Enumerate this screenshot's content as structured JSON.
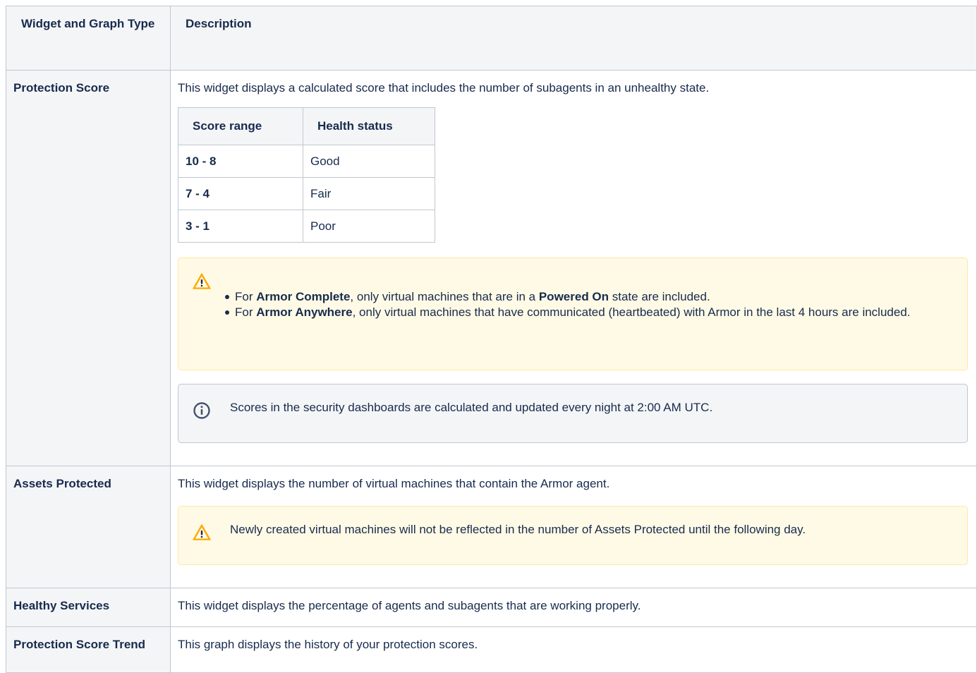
{
  "header": {
    "col1": "Widget and Graph Type",
    "col2": "Description"
  },
  "rows": [
    {
      "name": "Protection Score",
      "description": "This widget displays a calculated score that includes the number of subagents in an unhealthy state.",
      "score_table": {
        "headers": [
          "Score range",
          "Health status"
        ],
        "rows": [
          [
            "10 - 8",
            "Good"
          ],
          [
            "7 - 4",
            "Fair"
          ],
          [
            "3 - 1",
            "Poor"
          ]
        ]
      },
      "warning": {
        "icon": "warning-icon",
        "bullets": [
          {
            "pre": "For ",
            "b1": "Armor Complete",
            "mid": ", only virtual machines that are in a ",
            "b2": "Powered On",
            "post": " state are included."
          },
          {
            "pre": "For ",
            "b1": "Armor Anywhere",
            "mid": ", only virtual machines that have communicated (heartbeated) with Armor in the last 4 hours are included."
          }
        ]
      },
      "info": {
        "icon": "info-icon",
        "text": "Scores in the security dashboards are calculated and updated every night at 2:00 AM UTC."
      }
    },
    {
      "name": "Assets Protected",
      "description": "This widget displays the number of virtual machines that contain the Armor agent.",
      "warning": {
        "icon": "warning-icon",
        "text": "Newly created virtual machines will not be reflected in the number of Assets Protected until the following day."
      }
    },
    {
      "name": "Healthy Services",
      "description": "This widget displays the percentage of agents and subagents that are working properly."
    },
    {
      "name": "Protection Score Trend",
      "description": "This graph displays the history of your protection scores."
    }
  ],
  "colors": {
    "warning_bg": "#fffae6",
    "warning_icon": "#ffab00",
    "info_icon": "#42526e",
    "border": "#c1c7d0"
  }
}
